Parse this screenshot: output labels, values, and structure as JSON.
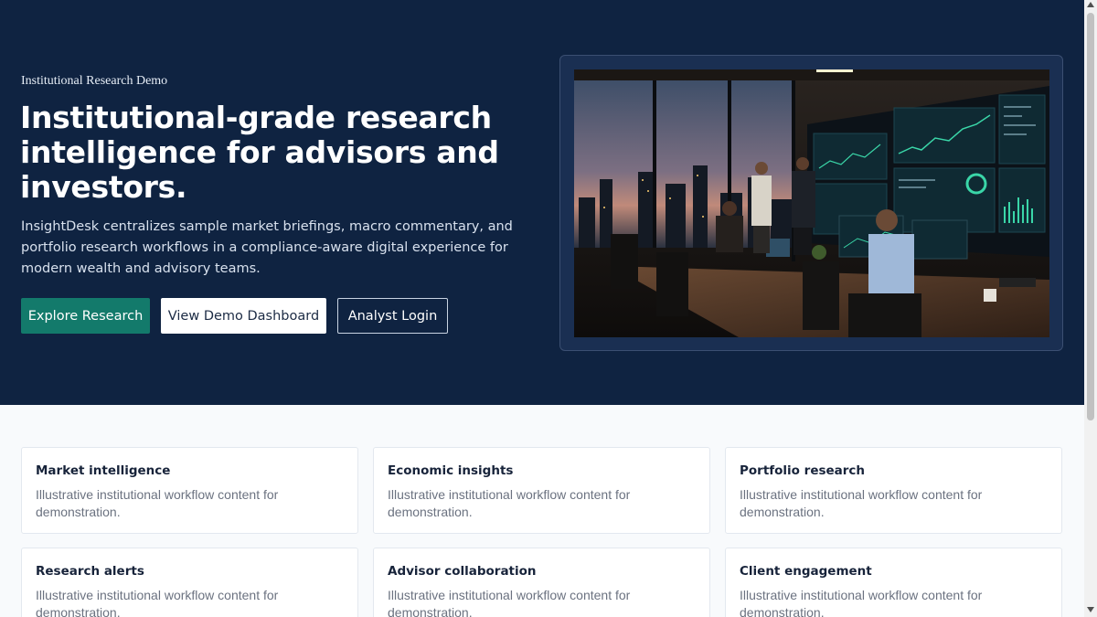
{
  "hero": {
    "eyebrow": "Institutional Research Demo",
    "headline": "Institutional-grade research intelligence for advisors and investors.",
    "lead": "InsightDesk centralizes sample market briefings, macro commentary, and portfolio research workflows in a compliance-aware digital experience for modern wealth and advisory teams.",
    "buttons": {
      "explore": "Explore Research",
      "dashboard": "View Demo Dashboard",
      "login": "Analyst Login"
    },
    "image_icon": "office-trading-floor-image"
  },
  "cards": [
    {
      "title": "Market intelligence",
      "text": "Illustrative institutional workflow content for demonstration."
    },
    {
      "title": "Economic insights",
      "text": "Illustrative institutional workflow content for demonstration."
    },
    {
      "title": "Portfolio research",
      "text": "Illustrative institutional workflow content for demonstration."
    },
    {
      "title": "Research alerts",
      "text": "Illustrative institutional workflow content for demonstration."
    },
    {
      "title": "Advisor collaboration",
      "text": "Illustrative institutional workflow content for demonstration."
    },
    {
      "title": "Client engagement",
      "text": "Illustrative institutional workflow content for demonstration."
    }
  ],
  "colors": {
    "hero_bg": "#0f2341",
    "primary": "#137a6b",
    "page_bg": "#f8fafc"
  }
}
